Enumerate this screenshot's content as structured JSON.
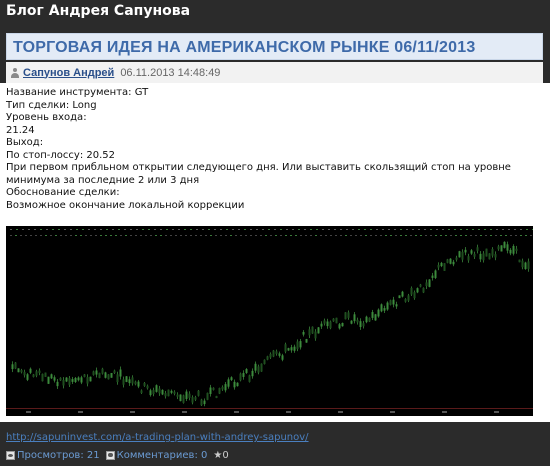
{
  "blog": {
    "title": "Блог Андрея Сапунова"
  },
  "post": {
    "title": "ТОРГОВАЯ ИДЕЯ НА АМЕРИКАНСКОМ РЫНКЕ 06/11/2013",
    "author": "Сапунов Андрей",
    "date": "06.11.2013 14:48:49",
    "lines": [
      "Название инструмента: GT",
      "Тип сделки: Long",
      " Уровень входа:",
      " 21.24",
      " Выход:",
      "По стоп-лоссу: 20.52",
      "При первом прибльном открытии следующего дня. Или выставить скользящий стоп на уровне",
      "минимума за последние 2 или 3 дня",
      " Обоснование сделки:",
      "Возможное окончание локальной коррекции"
    ]
  },
  "footer": {
    "link": "http://sapuninvest.com/a-trading-plan-with-andrey-sapunov/",
    "views": "Просмотров: 21",
    "comments": "Комментариев: 0",
    "rating": "★0"
  },
  "colors": {
    "background": "#2b2b2b",
    "heading_bg": "#e3ebf6",
    "heading_text": "#3e6aa9",
    "chart_bg": "#000000",
    "candle": "#2f6b2f"
  },
  "icons": {
    "author": "user-icon",
    "views": "eye-icon",
    "comments": "comment-icon"
  }
}
